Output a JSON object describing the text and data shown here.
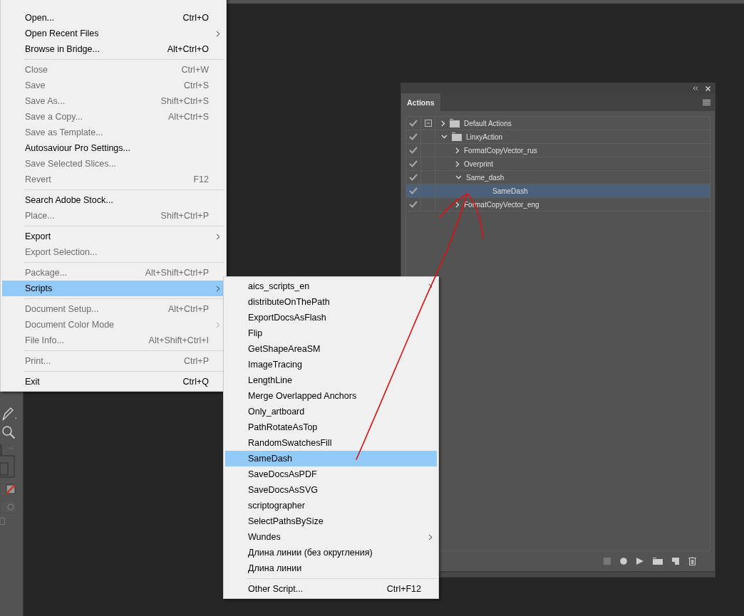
{
  "file_menu": {
    "items": [
      {
        "kind": "item",
        "label": "Open...",
        "shortcut": "Ctrl+O",
        "disabled": false,
        "submenu": false,
        "selected": false
      },
      {
        "kind": "item",
        "label": "Open Recent Files",
        "disabled": false,
        "submenu": true,
        "selected": false
      },
      {
        "kind": "item",
        "label": "Browse in Bridge...",
        "shortcut": "Alt+Ctrl+O",
        "disabled": false,
        "submenu": false,
        "selected": false
      },
      {
        "kind": "separator"
      },
      {
        "kind": "item",
        "label": "Close",
        "shortcut": "Ctrl+W",
        "disabled": true,
        "submenu": false,
        "selected": false
      },
      {
        "kind": "item",
        "label": "Save",
        "shortcut": "Ctrl+S",
        "disabled": true,
        "submenu": false,
        "selected": false
      },
      {
        "kind": "item",
        "label": "Save As...",
        "shortcut": "Shift+Ctrl+S",
        "disabled": true,
        "submenu": false,
        "selected": false
      },
      {
        "kind": "item",
        "label": "Save a Copy...",
        "shortcut": "Alt+Ctrl+S",
        "disabled": true,
        "submenu": false,
        "selected": false
      },
      {
        "kind": "item",
        "label": "Save as Template...",
        "disabled": true,
        "submenu": false,
        "selected": false
      },
      {
        "kind": "item",
        "label": "Autosaviour Pro Settings...",
        "disabled": false,
        "submenu": false,
        "selected": false
      },
      {
        "kind": "item",
        "label": "Save Selected Slices...",
        "disabled": true,
        "submenu": false,
        "selected": false
      },
      {
        "kind": "item",
        "label": "Revert",
        "shortcut": "F12",
        "disabled": true,
        "submenu": false,
        "selected": false
      },
      {
        "kind": "separator"
      },
      {
        "kind": "item",
        "label": "Search Adobe Stock...",
        "disabled": false,
        "submenu": false,
        "selected": false
      },
      {
        "kind": "item",
        "label": "Place...",
        "shortcut": "Shift+Ctrl+P",
        "disabled": true,
        "submenu": false,
        "selected": false
      },
      {
        "kind": "separator"
      },
      {
        "kind": "item",
        "label": "Export",
        "disabled": false,
        "submenu": true,
        "selected": false
      },
      {
        "kind": "item",
        "label": "Export Selection...",
        "disabled": true,
        "submenu": false,
        "selected": false
      },
      {
        "kind": "separator"
      },
      {
        "kind": "item",
        "label": "Package...",
        "shortcut": "Alt+Shift+Ctrl+P",
        "disabled": true,
        "submenu": false,
        "selected": false
      },
      {
        "kind": "item",
        "label": "Scripts",
        "disabled": false,
        "submenu": true,
        "selected": true
      },
      {
        "kind": "separator"
      },
      {
        "kind": "item",
        "label": "Document Setup...",
        "shortcut": "Alt+Ctrl+P",
        "disabled": true,
        "submenu": false,
        "selected": false
      },
      {
        "kind": "item",
        "label": "Document Color Mode",
        "disabled": true,
        "submenu": true,
        "selected": false
      },
      {
        "kind": "item",
        "label": "File Info...",
        "shortcut": "Alt+Shift+Ctrl+I",
        "disabled": true,
        "submenu": false,
        "selected": false
      },
      {
        "kind": "separator"
      },
      {
        "kind": "item",
        "label": "Print...",
        "shortcut": "Ctrl+P",
        "disabled": true,
        "submenu": false,
        "selected": false
      },
      {
        "kind": "separator"
      },
      {
        "kind": "item",
        "label": "Exit",
        "shortcut": "Ctrl+Q",
        "disabled": false,
        "submenu": false,
        "selected": false
      }
    ]
  },
  "scripts_menu": {
    "items": [
      {
        "kind": "item",
        "label": "aics_scripts_en",
        "disabled": false,
        "submenu": true,
        "selected": false
      },
      {
        "kind": "item",
        "label": "distributeOnThePath",
        "disabled": false,
        "submenu": false,
        "selected": false
      },
      {
        "kind": "item",
        "label": "ExportDocsAsFlash",
        "disabled": false,
        "submenu": false,
        "selected": false
      },
      {
        "kind": "item",
        "label": "Flip",
        "disabled": false,
        "submenu": false,
        "selected": false
      },
      {
        "kind": "item",
        "label": "GetShapeAreaSM",
        "disabled": false,
        "submenu": false,
        "selected": false
      },
      {
        "kind": "item",
        "label": "ImageTracing",
        "disabled": false,
        "submenu": false,
        "selected": false
      },
      {
        "kind": "item",
        "label": "LengthLine",
        "disabled": false,
        "submenu": false,
        "selected": false
      },
      {
        "kind": "item",
        "label": "Merge Overlapped Anchors",
        "disabled": false,
        "submenu": false,
        "selected": false
      },
      {
        "kind": "item",
        "label": "Only_artboard",
        "disabled": false,
        "submenu": false,
        "selected": false
      },
      {
        "kind": "item",
        "label": "PathRotateAsTop",
        "disabled": false,
        "submenu": false,
        "selected": false
      },
      {
        "kind": "item",
        "label": "RandomSwatchesFill",
        "disabled": false,
        "submenu": false,
        "selected": false
      },
      {
        "kind": "item",
        "label": "SameDash",
        "disabled": false,
        "submenu": false,
        "selected": true
      },
      {
        "kind": "item",
        "label": "SaveDocsAsPDF",
        "disabled": false,
        "submenu": false,
        "selected": false
      },
      {
        "kind": "item",
        "label": "SaveDocsAsSVG",
        "disabled": false,
        "submenu": false,
        "selected": false
      },
      {
        "kind": "item",
        "label": "scriptographer",
        "disabled": false,
        "submenu": false,
        "selected": false
      },
      {
        "kind": "item",
        "label": "SelectPathsBySize",
        "disabled": false,
        "submenu": false,
        "selected": false
      },
      {
        "kind": "item",
        "label": "Wundes",
        "disabled": false,
        "submenu": true,
        "selected": false
      },
      {
        "kind": "item",
        "label": "Длина линии (без округления)",
        "disabled": false,
        "submenu": false,
        "selected": false
      },
      {
        "kind": "item",
        "label": "Длина линии",
        "disabled": false,
        "submenu": false,
        "selected": false
      },
      {
        "kind": "separator"
      },
      {
        "kind": "item",
        "label": "Other Script...",
        "shortcut": "Ctrl+F12",
        "disabled": false,
        "submenu": false,
        "selected": false
      }
    ]
  },
  "actions_panel": {
    "tab": {
      "label": "Actions",
      "selected": true
    },
    "rows": [
      {
        "kind": "set",
        "label": "Default Actions",
        "checked": true,
        "dialog": true,
        "expanded": false,
        "selected": false
      },
      {
        "kind": "set",
        "label": "LinxyAction",
        "checked": true,
        "dialog": false,
        "expanded": true,
        "selected": false,
        "children": [
          {
            "kind": "action",
            "label": "FormatCopyVector_rus",
            "checked": true,
            "dialog": false,
            "expanded": false,
            "selected": false
          },
          {
            "kind": "action",
            "label": "Overprint",
            "checked": true,
            "dialog": false,
            "expanded": false,
            "selected": false
          },
          {
            "kind": "action",
            "label": "Same_dash",
            "checked": true,
            "dialog": false,
            "expanded": true,
            "selected": false,
            "children": [
              {
                "kind": "step",
                "label": "SameDash",
                "checked": true,
                "dialog": false,
                "selected": true
              }
            ]
          },
          {
            "kind": "action",
            "label": "FormatCopyVector_eng",
            "checked": true,
            "dialog": false,
            "expanded": false,
            "selected": false
          }
        ]
      }
    ]
  }
}
